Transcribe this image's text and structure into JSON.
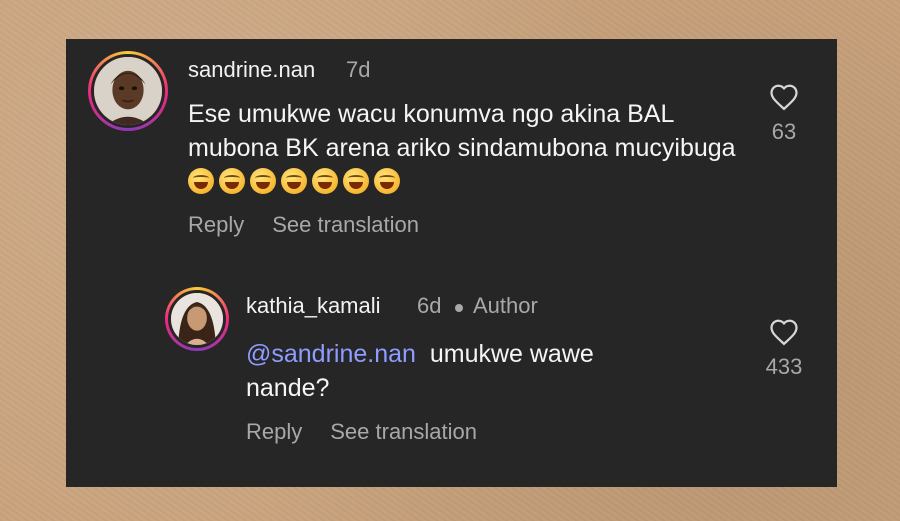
{
  "comments": [
    {
      "username": "sandrine.nan",
      "time": "7d",
      "text": "Ese umukwe wacu konumva ngo akina BAL mubona BK arena ariko sindamubona mucyibuga",
      "emoji_count": 7,
      "emoji_name": "face-with-tears-of-joy",
      "reply_label": "Reply",
      "translate_label": "See translation",
      "likes": "63"
    },
    {
      "username": "kathia_kamali",
      "time": "6d",
      "author_label": "Author",
      "mention": "@sandrine.nan",
      "text": "umukwe wawe nande?",
      "reply_label": "Reply",
      "translate_label": "See translation",
      "likes": "433"
    }
  ],
  "colors": {
    "background": "#262626",
    "mention": "#8e9dff",
    "muted": "#a8a8a8",
    "text": "#f5f5f5"
  }
}
